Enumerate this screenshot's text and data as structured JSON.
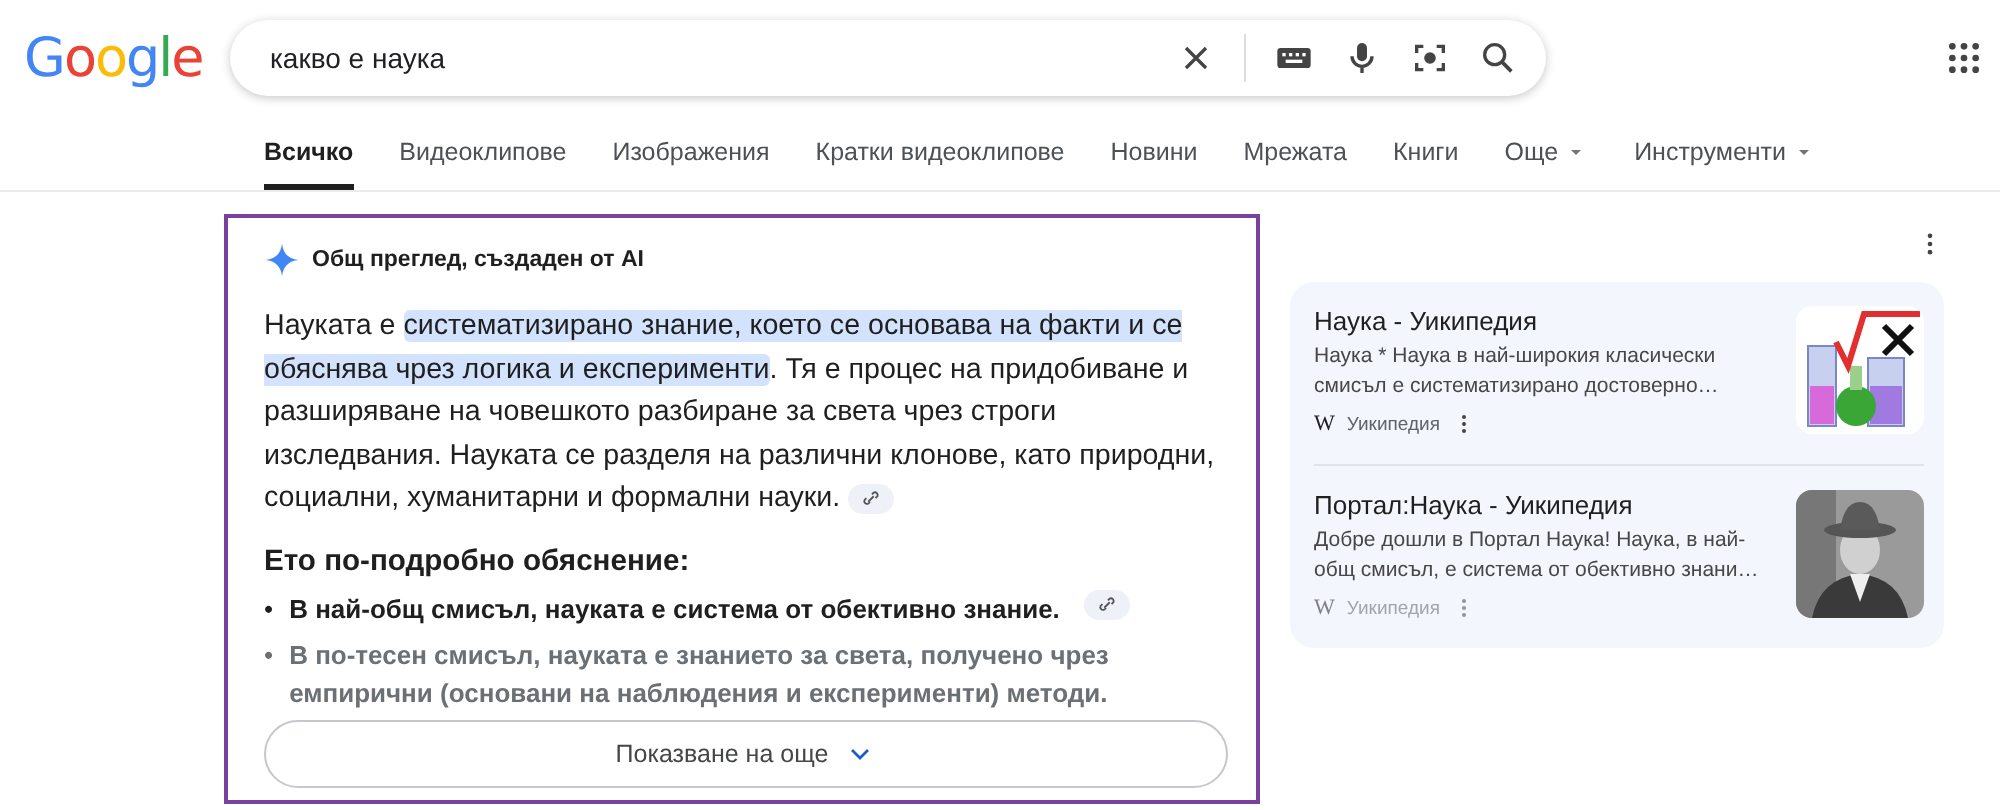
{
  "logo": "Google",
  "search": {
    "value": "какво е наука"
  },
  "tabs": [
    {
      "label": "Всичко",
      "selected": true,
      "kind": "tab"
    },
    {
      "label": "Видеоклипове",
      "selected": false,
      "kind": "tab"
    },
    {
      "label": "Изображения",
      "selected": false,
      "kind": "tab"
    },
    {
      "label": "Кратки видеоклипове",
      "selected": false,
      "kind": "tab"
    },
    {
      "label": "Новини",
      "selected": false,
      "kind": "tab"
    },
    {
      "label": "Мрежата",
      "selected": false,
      "kind": "tab"
    },
    {
      "label": "Книги",
      "selected": false,
      "kind": "tab"
    },
    {
      "label": "Още",
      "selected": false,
      "kind": "menu"
    },
    {
      "label": "Инструменти",
      "selected": false,
      "kind": "menu"
    }
  ],
  "ai_overview": {
    "header": "Общ преглед, създаден от AI",
    "paragraph": [
      {
        "text": "Науката е ",
        "highlighted": false
      },
      {
        "text": "систематизирано знание, което се основава на факти и се обяснява чрез логика и експерименти",
        "highlighted": true
      },
      {
        "text": ". Тя е процес на придобиване и разширяване на човешкото разбиране за света чрез строги изследвания. Науката се разделя на различни клонове, като природни, социални, хуманитарни и формални науки.",
        "highlighted": false
      }
    ],
    "subheading": "Ето по-подробно обяснение:",
    "bullets": [
      {
        "marker": "•",
        "text": "В най-общ смисъл, науката е система от обективно знание.",
        "faded": false
      },
      {
        "marker": "•",
        "text": "В по-тесен смисъл, науката е знанието за света, получено чрез емпирични (основани на наблюдения и експерименти) методи.",
        "faded": true
      }
    ],
    "show_more": "Показване на още"
  },
  "sources": [
    {
      "title": "Наука - Уикипедия",
      "snippet": "Наука * Наука в най-широкия класически смисъл е систематизирано достоверно…",
      "favicon": "W",
      "site": "Уикипедия",
      "faded": false
    },
    {
      "title": "Портал:Наука - Уикипедия",
      "snippet": "Добре дошли в Портал Наука! Наука, в най-общ смисъл, е система от обективно знани…",
      "favicon": "W",
      "site": "Уикипедия",
      "faded": true
    }
  ]
}
